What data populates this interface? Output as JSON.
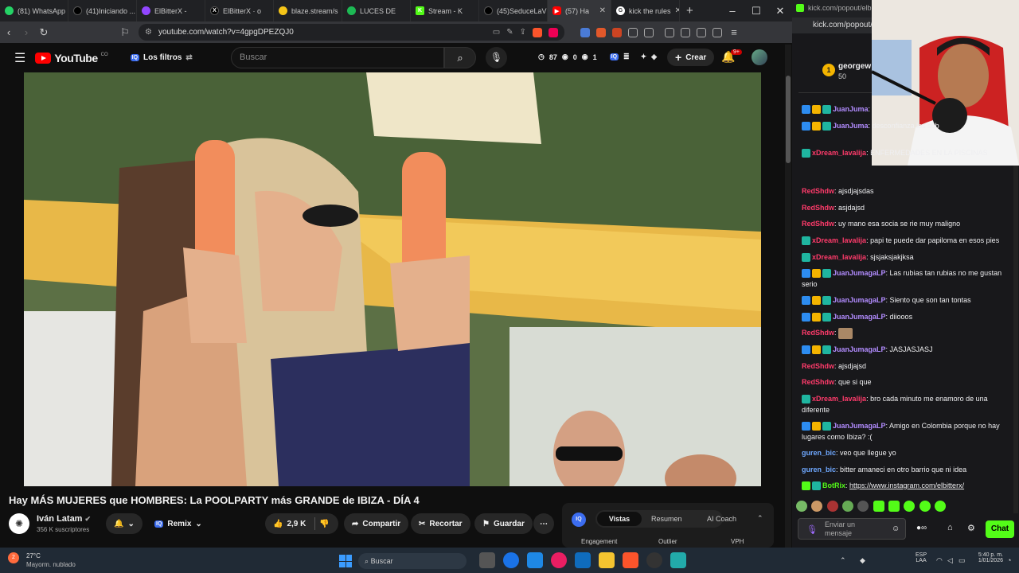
{
  "browser": {
    "tabs": [
      {
        "label": "(81) WhatsApp",
        "color": "#25d366"
      },
      {
        "label": "(41)Iniciando ...",
        "color": "#000000"
      },
      {
        "label": "ElBitterX -",
        "color": "#9146ff"
      },
      {
        "label": "ElBitterX · o",
        "color": "#000000"
      },
      {
        "label": "blaze.stream/s",
        "color": "#f5c518"
      },
      {
        "label": "LUCES DE",
        "color": "#1db954"
      },
      {
        "label": "Stream - K",
        "color": "#53fc18"
      },
      {
        "label": "(45)SeduceLaV",
        "color": "#000000"
      },
      {
        "label": "(57) Ha",
        "color": "#ff0000"
      },
      {
        "label": "kick the rules",
        "color": "#ffffff"
      }
    ],
    "url": "youtube.com/watch?v=4gpgDPEZQJ0",
    "popup_url": "kick.com/popout/elbitt"
  },
  "youtube": {
    "logo_text": "YouTube",
    "logo_sup": "CO",
    "filters_label": "Los filtros",
    "search_placeholder": "Buscar",
    "stat1": "87",
    "stat2": "0",
    "stat3": "1",
    "create_label": "Crear",
    "notif_count": "9+",
    "video_title": "Hay MÁS MUJERES que HOMBRES: La POOLPARTY más GRANDE de IBIZA - DÍA 4",
    "channel_name": "Iván Latam",
    "subscribers": "356 K suscriptores",
    "remix_label": "Remix",
    "likes": "2,9 K",
    "share_label": "Compartir",
    "clip_label": "Recortar",
    "save_label": "Guardar",
    "side_tabs": [
      "Vistas",
      "Resumen",
      "AI Coach"
    ],
    "side_headers": [
      "Engagement",
      "Outlier",
      "VPH"
    ]
  },
  "kick": {
    "top_user": "georgew",
    "top_amount": "50",
    "messages": [
      {
        "user": "JuanJuma",
        "color": "#b28cff",
        "text": ""
      },
      {
        "user": "JuanJuma",
        "color": "#b28cff",
        "text": "desconfianza los sub"
      },
      {
        "user": "xDream_lavalija",
        "color": "#ff3b6b",
        "text": "ENFERMEDADES EN LA PISCINAS"
      },
      {
        "user": "RedShdw",
        "color": "#ff3b6b",
        "text": "ajsdjajsdas"
      },
      {
        "user": "RedShdw",
        "color": "#ff3b6b",
        "text": "asjdajsd"
      },
      {
        "user": "RedShdw",
        "color": "#ff3b6b",
        "text": "uy mano esa socia se rie muy maligno"
      },
      {
        "user": "xDream_lavalija",
        "color": "#ff3b6b",
        "text": "papi te puede dar papiloma en esos pies"
      },
      {
        "user": "xDream_lavalija",
        "color": "#ff3b6b",
        "text": "sjsjaksjakjksa"
      },
      {
        "user": "JuanJumagaLP",
        "color": "#b28cff",
        "text": "Las rubias tan rubias no me gustan serio"
      },
      {
        "user": "JuanJumagaLP",
        "color": "#b28cff",
        "text": "Siento que son tan tontas"
      },
      {
        "user": "JuanJumagaLP",
        "color": "#b28cff",
        "text": "diiooos"
      },
      {
        "user": "RedShdw",
        "color": "#ff3b6b",
        "text": ""
      },
      {
        "user": "JuanJumagaLP",
        "color": "#b28cff",
        "text": "JASJASJASJ"
      },
      {
        "user": "RedShdw",
        "color": "#ff3b6b",
        "text": "ajsdjajsd"
      },
      {
        "user": "RedShdw",
        "color": "#ff3b6b",
        "text": "que si que"
      },
      {
        "user": "xDream_lavalija",
        "color": "#ff3b6b",
        "text": "bro cada minuto me enamoro de una diferente"
      },
      {
        "user": "JuanJumagaLP",
        "color": "#b28cff",
        "text": "Amigo en Colombia porque no hay lugares como Ibiza? :("
      },
      {
        "user": "guren_bic",
        "color": "#6fa8ff",
        "text": "veo que llegue yo"
      },
      {
        "user": "guren_bic",
        "color": "#6fa8ff",
        "text": "bitter amaneci en otro barrio que ni idea"
      },
      {
        "user": "BotRix",
        "color": "#53fc18",
        "text": "https://www.instagram.com/elbitterx/"
      }
    ],
    "input_placeholder": "Enviar un mensaje",
    "chat_button": "Chat"
  },
  "taskbar": {
    "weather_temp": "27°C",
    "weather_desc": "Mayorm. nublado",
    "search_label": "Buscar",
    "lang": "ESP",
    "lang2": "LAA",
    "time": "5:40 p. m.",
    "date": "1/01/2026"
  }
}
